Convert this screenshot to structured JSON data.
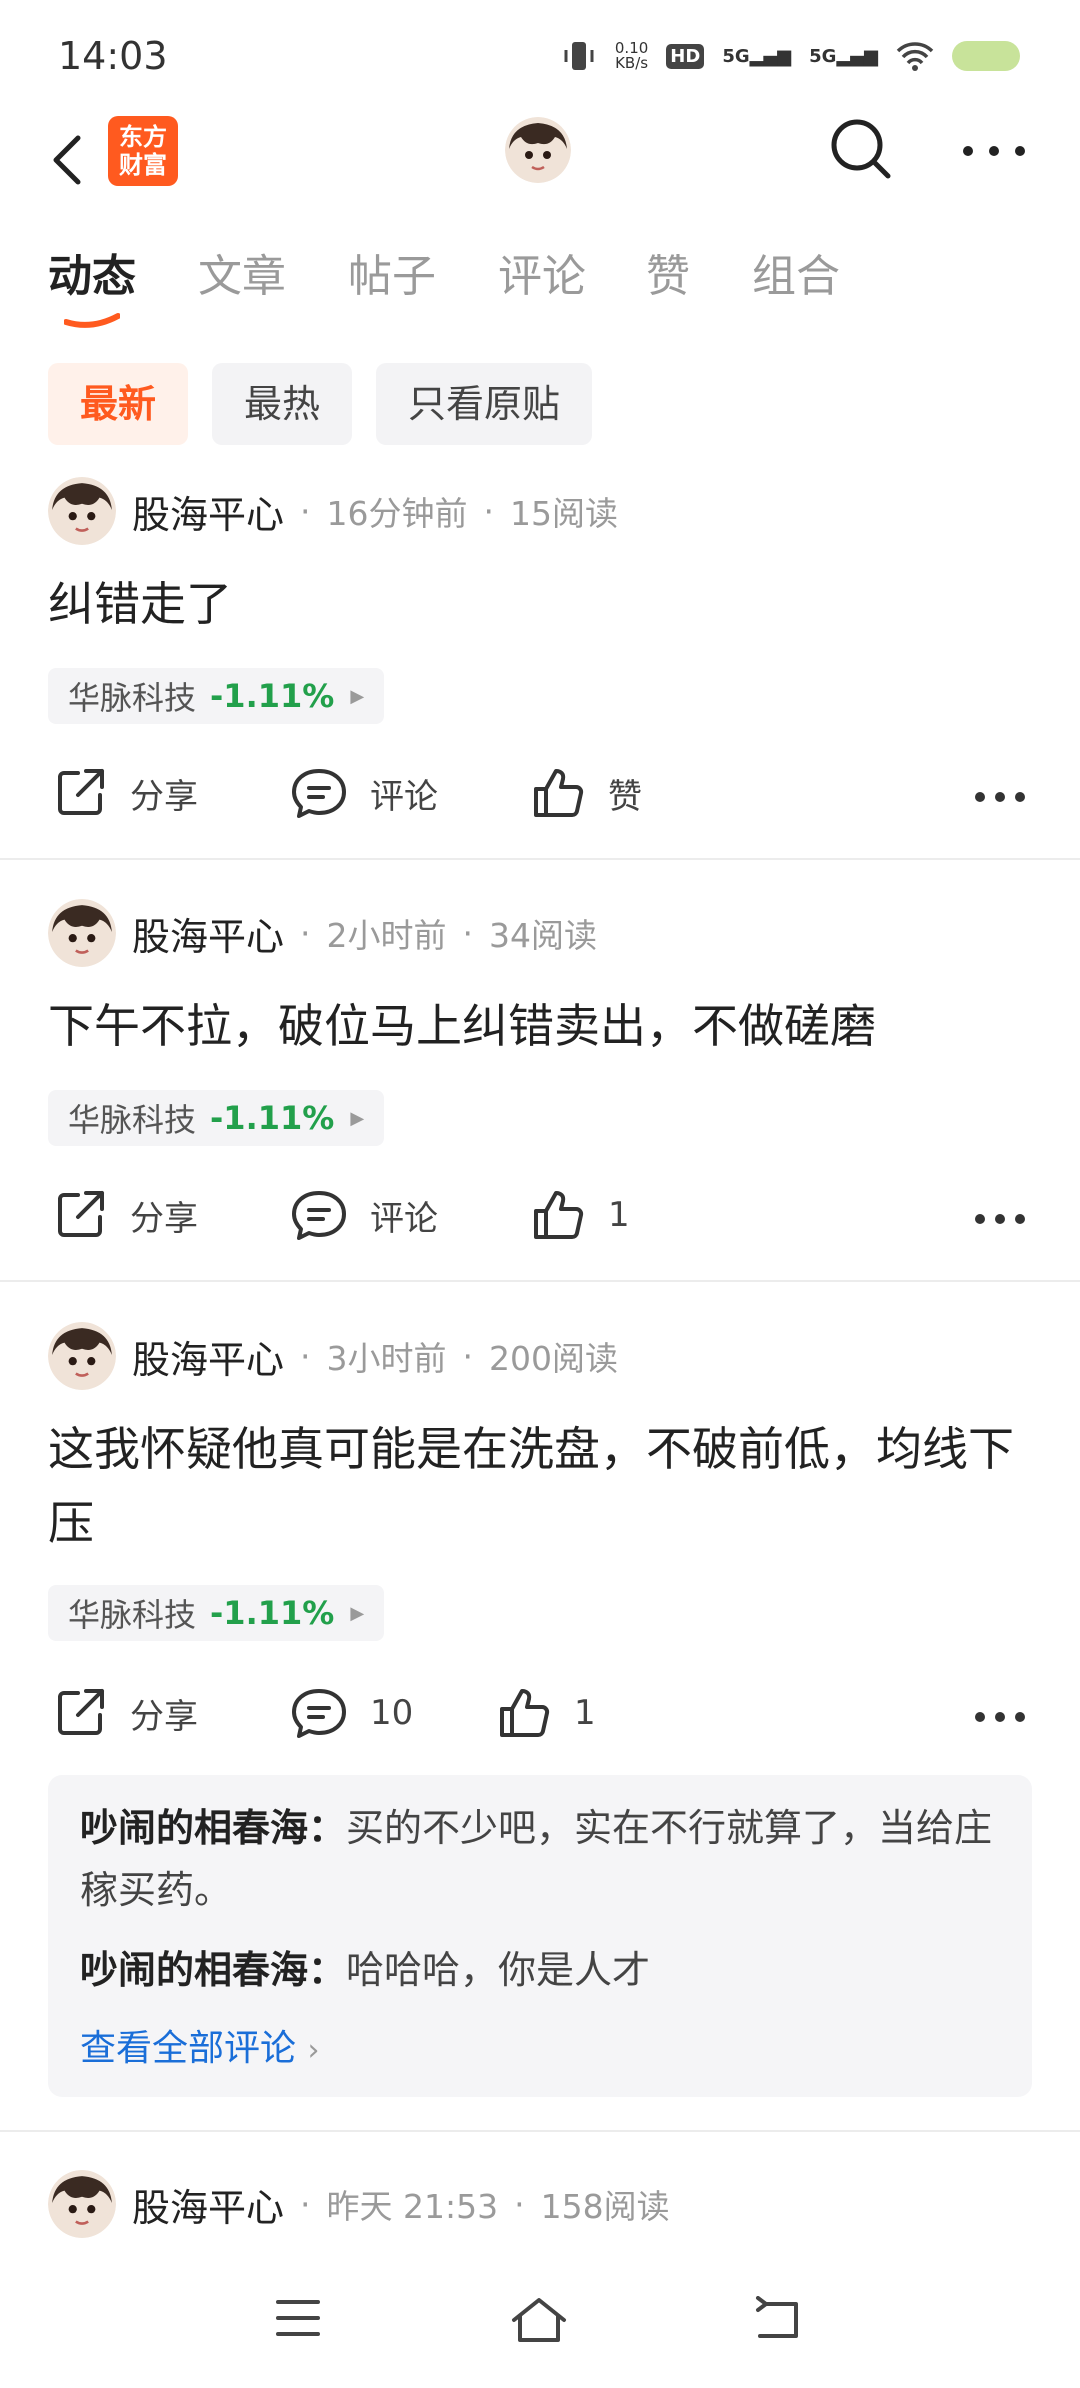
{
  "status_bar": {
    "time": "14:03",
    "net_speed_value": "0.10",
    "net_speed_unit": "KB/s",
    "hd": "HD",
    "sim1": "5G",
    "sim2": "5G"
  },
  "app_bar": {
    "logo_line1": "东方",
    "logo_line2": "财富"
  },
  "tabs": [
    {
      "label": "动态",
      "active": true
    },
    {
      "label": "文章"
    },
    {
      "label": "帖子"
    },
    {
      "label": "评论"
    },
    {
      "label": "赞"
    },
    {
      "label": "组合"
    }
  ],
  "filters": [
    {
      "label": "最新",
      "active": true
    },
    {
      "label": "最热"
    },
    {
      "label": "只看原贴"
    }
  ],
  "posts": [
    {
      "author": "股海平心",
      "time": "16分钟前",
      "reads": "15阅读",
      "content": "纠错走了",
      "stock_name": "华脉科技",
      "stock_change": "-1.11%",
      "share": "分享",
      "comment": "评论",
      "like": "赞"
    },
    {
      "author": "股海平心",
      "time": "2小时前",
      "reads": "34阅读",
      "content": "下午不拉，破位马上纠错卖出，不做磋磨",
      "stock_name": "华脉科技",
      "stock_change": "-1.11%",
      "share": "分享",
      "comment": "评论",
      "like": "1"
    },
    {
      "author": "股海平心",
      "time": "3小时前",
      "reads": "200阅读",
      "content": "这我怀疑他真可能是在洗盘，不破前低，均线下压",
      "stock_name": "华脉科技",
      "stock_change": "-1.11%",
      "share": "分享",
      "comment": "10",
      "like": "1",
      "comments": [
        {
          "user": "吵闹的相春海",
          "text": "买的不少吧，实在不行就算了，当给庄稼买药。"
        },
        {
          "user": "吵闹的相春海",
          "text": "哈哈哈，你是人才"
        }
      ],
      "view_all": "查看全部评论"
    },
    {
      "author": "股海平心",
      "time": "昨天 21:53",
      "reads": "158阅读"
    }
  ],
  "colors": {
    "accent": "#ff5a1f",
    "stock_down": "#22a04b",
    "link": "#1a6ed8"
  }
}
